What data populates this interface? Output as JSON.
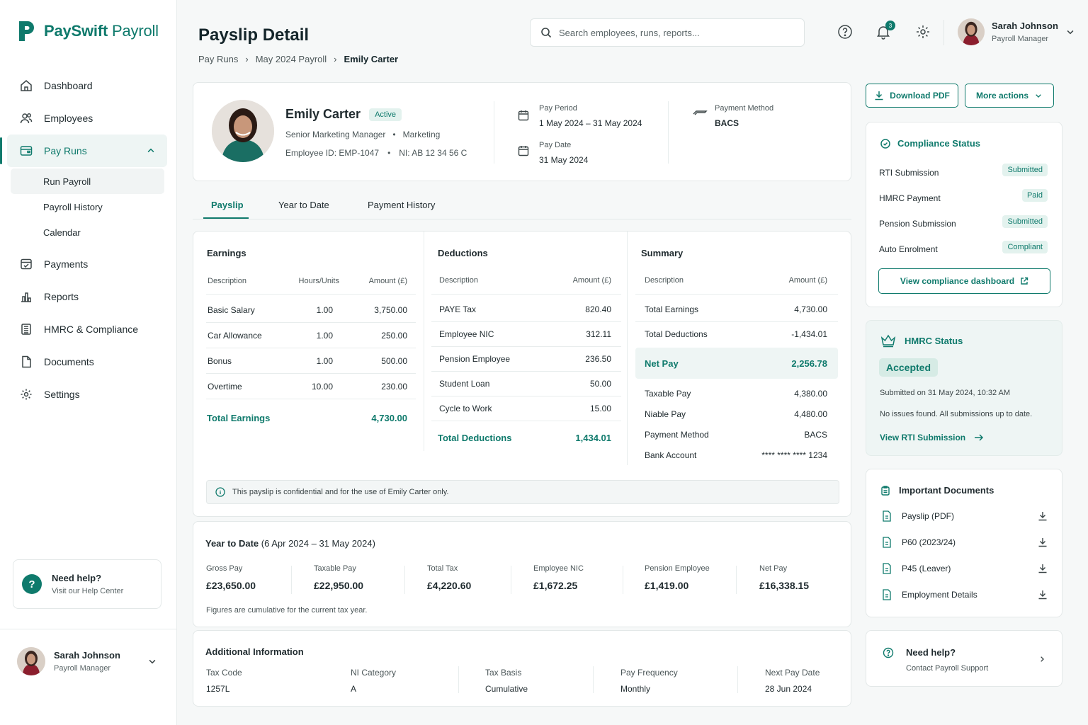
{
  "brand": {
    "name_bold": "PaySwift",
    "name_rest": " Payroll"
  },
  "nav": {
    "dashboard": "Dashboard",
    "employees": "Employees",
    "pay_runs": "Pay Runs",
    "run_payroll": "Run Payroll",
    "payroll_history": "Payroll History",
    "calendar": "Calendar",
    "payments": "Payments",
    "reports": "Reports",
    "hmrc": "HMRC & Compliance",
    "documents": "Documents",
    "settings": "Settings"
  },
  "side_help": {
    "title": "Need help?",
    "subtitle": "Visit our Help Center",
    "icon": "?"
  },
  "user": {
    "name": "Sarah Johnson",
    "role": "Payroll Manager"
  },
  "header": {
    "title": "Payslip Detail",
    "breadcrumbs": [
      "Pay Runs",
      "May 2024 Payroll",
      "Emily Carter"
    ],
    "search_placeholder": "Search employees, runs, reports...",
    "notifications": "3"
  },
  "employee": {
    "name": "Emily Carter",
    "status": "Active",
    "title": "Senior Marketing Manager",
    "department": "Marketing",
    "employee_id": "Employee ID: EMP-1047",
    "ni": "NI: AB 12 34 56 C",
    "pay_period_label": "Pay Period",
    "pay_period": "1 May 2024 – 31 May 2024",
    "pay_date_label": "Pay Date",
    "pay_date": "31 May 2024",
    "payment_method_label": "Payment Method",
    "payment_method": "BACS"
  },
  "tabs": [
    "Payslip",
    "Year to Date",
    "Payment History"
  ],
  "earnings": {
    "title": "Earnings",
    "headers": [
      "Description",
      "Hours/Units",
      "Amount (£)"
    ],
    "rows": [
      {
        "desc": "Basic Salary",
        "units": "1.00",
        "amount": "3,750.00"
      },
      {
        "desc": "Car Allowance",
        "units": "1.00",
        "amount": "250.00"
      },
      {
        "desc": "Bonus",
        "units": "1.00",
        "amount": "500.00"
      },
      {
        "desc": "Overtime",
        "units": "10.00",
        "amount": "230.00"
      }
    ],
    "total_label": "Total Earnings",
    "total": "4,730.00"
  },
  "deductions": {
    "title": "Deductions",
    "headers": [
      "Description",
      "Amount (£)"
    ],
    "rows": [
      {
        "desc": "PAYE Tax",
        "amount": "820.40"
      },
      {
        "desc": "Employee NIC",
        "amount": "312.11"
      },
      {
        "desc": "Pension Employee",
        "amount": "236.50"
      },
      {
        "desc": "Student Loan",
        "amount": "50.00"
      },
      {
        "desc": "Cycle to Work",
        "amount": "15.00"
      }
    ],
    "total_label": "Total Deductions",
    "total": "1,434.01"
  },
  "summary": {
    "title": "Summary",
    "headers": [
      "Description",
      "Amount (£)"
    ],
    "rows_top": [
      {
        "desc": "Total Earnings",
        "amount": "4,730.00"
      },
      {
        "desc": "Total Deductions",
        "amount": "-1,434.01"
      }
    ],
    "net_label": "Net Pay",
    "net": "2,256.78",
    "rows_bottom": [
      {
        "desc": "Taxable Pay",
        "amount": "4,380.00"
      },
      {
        "desc": "Niable Pay",
        "amount": "4,480.00"
      },
      {
        "desc": "Payment Method",
        "amount": "BACS"
      },
      {
        "desc": "Bank Account",
        "amount": "**** **** **** 1234"
      }
    ]
  },
  "confidential_note": "This payslip is confidential and for the use of Emily Carter only.",
  "ytd": {
    "title": "Year to Date",
    "range": "(6 Apr 2024 – 31 May 2024)",
    "items": [
      {
        "label": "Gross Pay",
        "value": "£23,650.00"
      },
      {
        "label": "Taxable Pay",
        "value": "£22,950.00"
      },
      {
        "label": "Total Tax",
        "value": "£4,220.60"
      },
      {
        "label": "Employee NIC",
        "value": "£1,672.25"
      },
      {
        "label": "Pension Employee",
        "value": "£1,419.00"
      },
      {
        "label": "Net Pay",
        "value": "£16,338.15"
      }
    ],
    "note": "Figures are cumulative for the current tax year."
  },
  "additional": {
    "title": "Additional Information",
    "items": [
      {
        "label": "Tax Code",
        "value": "1257L"
      },
      {
        "label": "NI Category",
        "value": "A"
      },
      {
        "label": "Tax Basis",
        "value": "Cumulative"
      },
      {
        "label": "Pay Frequency",
        "value": "Monthly"
      },
      {
        "label": "Next Pay Date",
        "value": "28 Jun 2024"
      }
    ]
  },
  "actions": {
    "download": "Download PDF",
    "more": "More actions"
  },
  "compliance": {
    "title": "Compliance Status",
    "rows": [
      {
        "label": "RTI Submission",
        "status": "Submitted"
      },
      {
        "label": "HMRC Payment",
        "status": "Paid"
      },
      {
        "label": "Pension Submission",
        "status": "Submitted"
      },
      {
        "label": "Auto Enrolment",
        "status": "Compliant"
      }
    ],
    "button": "View compliance dashboard"
  },
  "hmrc_status": {
    "title": "HMRC Status",
    "state": "Accepted",
    "submitted": "Submitted on 31 May 2024, 10:32 AM",
    "message": "No issues found. All submissions up to date.",
    "link": "View RTI Submission"
  },
  "documents": {
    "title": "Important Documents",
    "items": [
      "Payslip (PDF)",
      "P60 (2023/24)",
      "P45 (Leaver)",
      "Employment Details"
    ]
  },
  "support": {
    "title": "Need help?",
    "subtitle": "Contact Payroll Support"
  },
  "colors": {
    "brand": "#0f7a6c",
    "pill_bg": "#e3f2ee",
    "hmrc_bg": "#eef5f4"
  }
}
